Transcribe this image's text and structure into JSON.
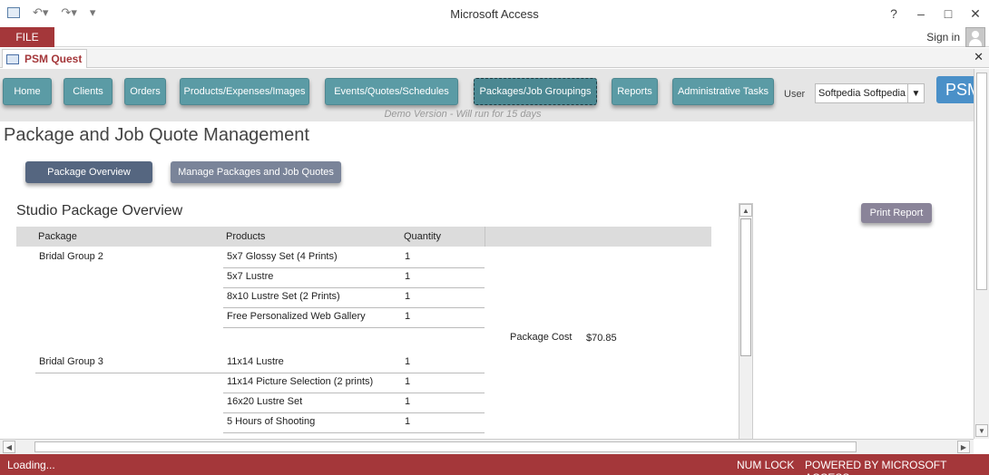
{
  "window": {
    "title": "Microsoft Access",
    "help": "?",
    "minimize": "–",
    "maximize": "□",
    "close": "✕"
  },
  "ribbon": {
    "file_tab": "FILE",
    "sign_in": "Sign in"
  },
  "document_tab": {
    "label": "PSM Quest",
    "close": "✕"
  },
  "nav": {
    "buttons": [
      {
        "label": "Home",
        "active": false
      },
      {
        "label": "Clients",
        "active": false
      },
      {
        "label": "Orders",
        "active": false
      },
      {
        "label": "Products/Expenses/Images",
        "active": false
      },
      {
        "label": "Events/Quotes/Schedules",
        "active": false
      },
      {
        "label": "Packages/Job Groupings",
        "active": true
      },
      {
        "label": "Reports",
        "active": false
      },
      {
        "label": "Administrative Tasks",
        "active": false
      }
    ],
    "user_label": "User",
    "user_value": "Softpedia Softpedia",
    "badge": "PSM",
    "demo_text": "Demo Version - Will run for 15 days"
  },
  "page": {
    "title": "Package and Job Quote Management",
    "sub_buttons": [
      "Package  Overview",
      "Manage Packages and Job Quotes"
    ],
    "section_title": "Studio Package Overview",
    "print_button": "Print Report"
  },
  "report": {
    "columns": [
      "Package",
      "Products",
      "Quantity"
    ],
    "groups": [
      {
        "package": "Bridal Group 2",
        "items": [
          {
            "product": "5x7 Glossy Set (4 Prints)",
            "qty": "1"
          },
          {
            "product": "5x7 Lustre",
            "qty": "1"
          },
          {
            "product": "8x10 Lustre Set  (2 Prints)",
            "qty": "1"
          },
          {
            "product": "Free Personalized Web Gallery",
            "qty": "1"
          }
        ],
        "cost_label": "Package Cost",
        "cost_value": "$70.85"
      },
      {
        "package": "Bridal Group 3",
        "items": [
          {
            "product": "11x14 Lustre",
            "qty": "1"
          },
          {
            "product": "11x14 Picture Selection (2 prints)",
            "qty": "1"
          },
          {
            "product": "16x20 Lustre Set",
            "qty": "1"
          },
          {
            "product": "5 Hours of Shooting",
            "qty": "1"
          }
        ]
      }
    ]
  },
  "status": {
    "left": "Loading...",
    "num_lock": "NUM LOCK",
    "powered": "POWERED BY MICROSOFT ACCESS"
  }
}
